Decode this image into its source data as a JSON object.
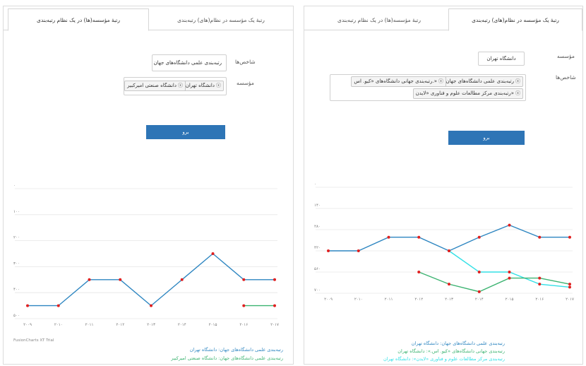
{
  "left": {
    "tab_active": "رتبهٔ مؤسسه(ها) در یک نظام رتبه‌بندی",
    "tab_inactive": "رتبهٔ یک مؤسسه در نظام(های) رتبه‌بندی",
    "indicator_label": "شاخص‌ها",
    "indicator_value": "رتبه‌بندی علمی دانشگاه‌های جهان",
    "institution_label": "مؤسسه",
    "chips": [
      "دانشگاه تهران",
      "دانشگاه صنعتی امیرکبیر"
    ],
    "submit_label": "برو",
    "trial_text": "FusionCharts XT Trial",
    "legend": [
      "رتبه‌بندی علمی دانشگاه‌های جهان: دانشگاه تهران",
      "رتبه‌بندی علمی دانشگاه‌های جهان: دانشگاه صنعتی امیرکبیر"
    ]
  },
  "right": {
    "tab_active": "رتبهٔ یک مؤسسه در نظام(های) رتبه‌بندی",
    "tab_inactive": "رتبهٔ مؤسسه(ها) در یک نظام رتبه‌بندی",
    "institution_label": "مؤسسه",
    "institution_value": "دانشگاه تهران",
    "indicator_label": "شاخص‌ها",
    "chips": [
      "رتبه‌بندی علمی دانشگاه‌های جهان",
      "رتبه‌بندی جهانی دانشگاه‌های «کیو. اس.»",
      "رتبه‌بندی مرکز مطالعات علوم و فناوری «لایدن»"
    ],
    "submit_label": "برو",
    "legend": [
      "رتبه‌بندی علمی دانشگاه‌های جهان: دانشگاه تهران",
      "رتبه‌بندی جهانی دانشگاه‌های «کیو. اس.»: دانشگاه تهران",
      "رتبه‌بندی مرکز مطالعات علوم و فناوری «لایدن»: دانشگاه تهران"
    ]
  },
  "colors": {
    "blue": "#2e86c1",
    "green": "#3cb371",
    "cyan": "#33e0e6",
    "marker": "#e02020",
    "button": "#2e75b6"
  },
  "chart_data": [
    {
      "type": "line",
      "categories": [
        "۲۰۰۹",
        "۲۰۱۰",
        "۲۰۱۱",
        "۲۰۱۲",
        "۲۰۱۳",
        "۲۰۱۴",
        "۲۰۱۵",
        "۲۰۱۶",
        "۲۰۱۷"
      ],
      "yticks": [
        "۰",
        "۱۰۰",
        "۲۰۰",
        "۳۰۰",
        "۴۰۰",
        "۵۰۰"
      ],
      "ylim": [
        500,
        0
      ],
      "reversed_y": true,
      "series": [
        {
          "name": "رتبه‌بندی علمی دانشگاه‌های جهان: دانشگاه تهران",
          "color": "#2e86c1",
          "values": [
            450,
            450,
            350,
            350,
            450,
            350,
            250,
            350,
            350
          ]
        },
        {
          "name": "رتبه‌بندی علمی دانشگاه‌های جهان: دانشگاه صنعتی امیرکبیر",
          "color": "#3cb371",
          "values": [
            null,
            null,
            null,
            null,
            null,
            null,
            null,
            450,
            450
          ]
        }
      ]
    },
    {
      "type": "line",
      "categories": [
        "۲۰۰۹",
        "۲۰۱۰",
        "۲۰۱۱",
        "۲۰۱۲",
        "۲۰۱۳",
        "۲۰۱۴",
        "۲۰۱۵",
        "۲۰۱۶",
        "۲۰۱۷"
      ],
      "yticks": [
        "۰",
        "۱۴۰",
        "۲۸۰",
        "۴۲۰",
        "۵۶۰",
        "۷۰۰"
      ],
      "ylim": [
        700,
        0
      ],
      "reversed_y": true,
      "series": [
        {
          "name": "رتبه‌بندی علمی دانشگاه‌های جهان: دانشگاه تهران",
          "color": "#2e86c1",
          "values": [
            420,
            420,
            330,
            330,
            420,
            330,
            250,
            330,
            330
          ]
        },
        {
          "name": "رتبه‌بندی جهانی دانشگاه‌های «کیو. اس.»: دانشگاه تهران",
          "color": "#33e0e6",
          "values": [
            null,
            null,
            null,
            null,
            420,
            560,
            560,
            640,
            660
          ]
        },
        {
          "name": "رتبه‌بندی مرکز مطالعات علوم و فناوری «لایدن»: دانشگاه تهران",
          "color": "#3cb371",
          "values": [
            null,
            null,
            null,
            560,
            640,
            690,
            600,
            600,
            640
          ]
        }
      ]
    }
  ]
}
